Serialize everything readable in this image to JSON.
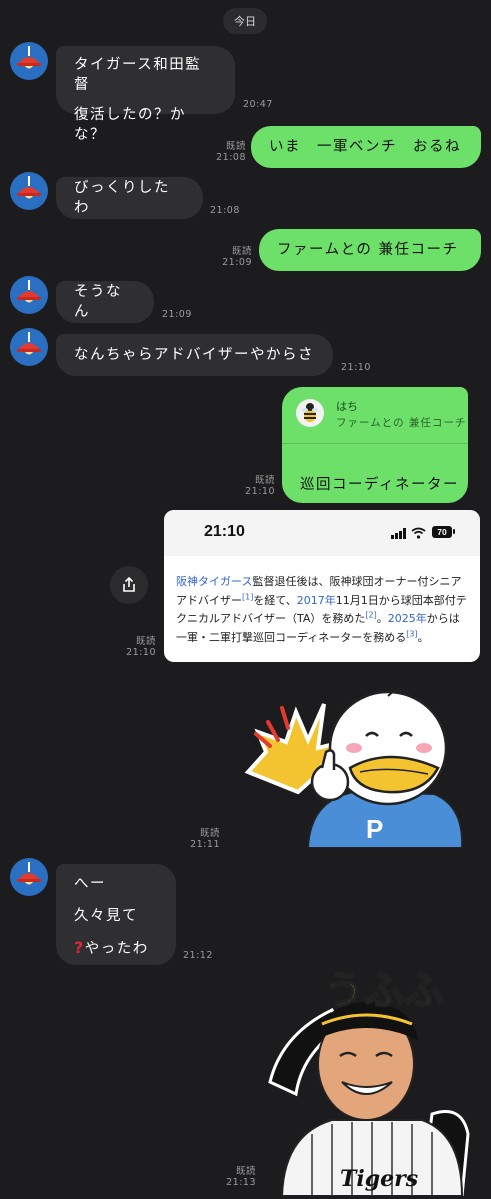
{
  "date_label": "今日",
  "read_label": "既読",
  "messages": {
    "m1": {
      "lines": [
        "タイガース和田監督",
        "復活したの？かな？"
      ],
      "time": "20:47"
    },
    "m2": {
      "text": "いま　一軍ベンチ　おるね",
      "time": "21:08"
    },
    "m3": {
      "text": "びっくりしたわ",
      "time": "21:08"
    },
    "m4": {
      "text": "ファームとの 兼任コーチ",
      "time": "21:09"
    },
    "m5": {
      "text": "そうなん",
      "time": "21:09"
    },
    "m6": {
      "text": "なんちゃらアドバイザーやからさ",
      "time": "21:10"
    },
    "m7": {
      "quote_name": "はち",
      "quote_text": "ファームとの 兼任コーチ",
      "text": "巡回コーディネーター",
      "time": "21:10"
    },
    "m8": {
      "time": "21:10"
    },
    "m9": {
      "time": "21:11"
    },
    "m10": {
      "lines": [
        "へー",
        "久々見て",
        "やったわ"
      ],
      "time": "21:12"
    },
    "m11": {
      "time": "21:13",
      "sticker_text": "うふふ",
      "shirt_text": "Tigers"
    }
  },
  "screenshot": {
    "status_time": "21:10",
    "battery": "70",
    "parts": [
      {
        "t": "阪神タイガース",
        "link": true
      },
      {
        "t": "監督退任後は、阪神球団オーナー付シニアアドバイザー",
        "link": false
      },
      {
        "t": "[1]",
        "link": true,
        "sup": true
      },
      {
        "t": "を経て、",
        "link": false
      },
      {
        "t": "2017年",
        "link": true
      },
      {
        "t": "11月1日から球団本部付テクニカルアドバイザー（TA）を務めた",
        "link": false
      },
      {
        "t": "[2]",
        "link": true,
        "sup": true
      },
      {
        "t": "。",
        "link": false
      },
      {
        "t": "2025年",
        "link": true
      },
      {
        "t": "からは一軍・二軍打撃巡回コーディネーターを務める",
        "link": false
      },
      {
        "t": "[3]",
        "link": true,
        "sup": true
      },
      {
        "t": "。",
        "link": false
      }
    ]
  },
  "sticker_duck": {
    "shirt_letter": "P"
  },
  "colors": {
    "background": "#1c1c1e",
    "incoming": "#2f2f31",
    "outgoing": "#6de06a",
    "link": "#3366cc",
    "avatar": "#2b6fc2"
  }
}
